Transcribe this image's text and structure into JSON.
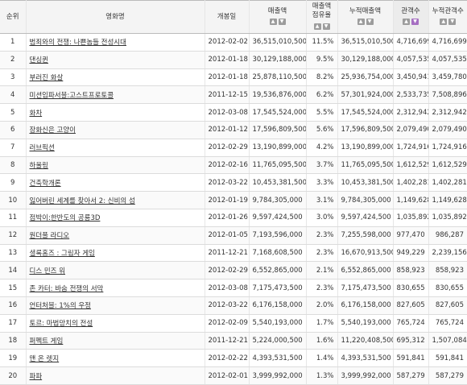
{
  "headers": {
    "rank": "순위",
    "title": "영화명",
    "release": "개봉일",
    "sales": "매출액",
    "share_line1": "매출액",
    "share_line2": "점유율",
    "cum_sales": "누적매출액",
    "audience": "관객수",
    "cum_audience": "누적관객수"
  },
  "sort_icons": {
    "up": "▲",
    "down": "▼"
  },
  "sort_active_color": "#a66fc2",
  "rows": [
    {
      "rank": "1",
      "title": "범죄와의 전쟁: 나쁜놈들 전성시대",
      "release": "2012-02-02",
      "sales": "36,515,010,500",
      "share": "11.5%",
      "cum_sales": "36,515,010,500",
      "audience": "4,716,699",
      "cum_audience": "4,716,699"
    },
    {
      "rank": "2",
      "title": "댄싱퀸",
      "release": "2012-01-18",
      "sales": "30,129,188,000",
      "share": "9.5%",
      "cum_sales": "30,129,188,000",
      "audience": "4,057,535",
      "cum_audience": "4,057,535"
    },
    {
      "rank": "3",
      "title": "부러진 화살",
      "release": "2012-01-18",
      "sales": "25,878,110,500",
      "share": "8.2%",
      "cum_sales": "25,936,754,000",
      "audience": "3,450,941",
      "cum_audience": "3,459,780"
    },
    {
      "rank": "4",
      "title": "미션임파서블:고스트프로토콜",
      "release": "2011-12-15",
      "sales": "19,536,876,000",
      "share": "6.2%",
      "cum_sales": "57,301,924,000",
      "audience": "2,533,735",
      "cum_audience": "7,508,896"
    },
    {
      "rank": "5",
      "title": "화차",
      "release": "2012-03-08",
      "sales": "17,545,524,000",
      "share": "5.5%",
      "cum_sales": "17,545,524,000",
      "audience": "2,312,942",
      "cum_audience": "2,312,942"
    },
    {
      "rank": "6",
      "title": "장화신은 고양이",
      "release": "2012-01-12",
      "sales": "17,596,809,500",
      "share": "5.6%",
      "cum_sales": "17,596,809,500",
      "audience": "2,079,490",
      "cum_audience": "2,079,490"
    },
    {
      "rank": "7",
      "title": "러브픽션",
      "release": "2012-02-29",
      "sales": "13,190,899,000",
      "share": "4.2%",
      "cum_sales": "13,190,899,000",
      "audience": "1,724,916",
      "cum_audience": "1,724,916"
    },
    {
      "rank": "8",
      "title": "하울링",
      "release": "2012-02-16",
      "sales": "11,765,095,500",
      "share": "3.7%",
      "cum_sales": "11,765,095,500",
      "audience": "1,612,529",
      "cum_audience": "1,612,529"
    },
    {
      "rank": "9",
      "title": "건축학개론",
      "release": "2012-03-22",
      "sales": "10,453,381,500",
      "share": "3.3%",
      "cum_sales": "10,453,381,500",
      "audience": "1,402,281",
      "cum_audience": "1,402,281"
    },
    {
      "rank": "10",
      "title": "잃어버린 세계를 찾아서 2: 신비의 섬",
      "release": "2012-01-19",
      "sales": "9,784,305,000",
      "share": "3.1%",
      "cum_sales": "9,784,305,000",
      "audience": "1,149,628",
      "cum_audience": "1,149,628"
    },
    {
      "rank": "11",
      "title": "점박이:한반도의 공룡3D",
      "release": "2012-01-26",
      "sales": "9,597,424,500",
      "share": "3.0%",
      "cum_sales": "9,597,424,500",
      "audience": "1,035,892",
      "cum_audience": "1,035,892"
    },
    {
      "rank": "12",
      "title": "원더풀 라디오",
      "release": "2012-01-05",
      "sales": "7,193,596,000",
      "share": "2.3%",
      "cum_sales": "7,255,598,000",
      "audience": "977,470",
      "cum_audience": "986,287"
    },
    {
      "rank": "13",
      "title": "셜록홈즈 : 그림자 게임",
      "release": "2011-12-21",
      "sales": "7,168,608,500",
      "share": "2.3%",
      "cum_sales": "16,670,913,500",
      "audience": "949,229",
      "cum_audience": "2,239,156"
    },
    {
      "rank": "14",
      "title": "디스 민즈 워",
      "release": "2012-02-29",
      "sales": "6,552,865,000",
      "share": "2.1%",
      "cum_sales": "6,552,865,000",
      "audience": "858,923",
      "cum_audience": "858,923"
    },
    {
      "rank": "15",
      "title": "존 카터: 바숨 전쟁의 서막",
      "release": "2012-03-08",
      "sales": "7,175,473,500",
      "share": "2.3%",
      "cum_sales": "7,175,473,500",
      "audience": "830,655",
      "cum_audience": "830,655"
    },
    {
      "rank": "16",
      "title": "언터처블: 1%의 우정",
      "release": "2012-03-22",
      "sales": "6,176,158,000",
      "share": "2.0%",
      "cum_sales": "6,176,158,000",
      "audience": "827,605",
      "cum_audience": "827,605"
    },
    {
      "rank": "17",
      "title": "토르: 마법망치의 전설",
      "release": "2012-02-09",
      "sales": "5,540,193,000",
      "share": "1.7%",
      "cum_sales": "5,540,193,000",
      "audience": "765,724",
      "cum_audience": "765,724"
    },
    {
      "rank": "18",
      "title": "퍼펙트 게임",
      "release": "2011-12-21",
      "sales": "5,224,000,500",
      "share": "1.6%",
      "cum_sales": "11,220,408,500",
      "audience": "695,312",
      "cum_audience": "1,507,084"
    },
    {
      "rank": "19",
      "title": "맨 온 렛지",
      "release": "2012-02-22",
      "sales": "4,393,531,500",
      "share": "1.4%",
      "cum_sales": "4,393,531,500",
      "audience": "591,841",
      "cum_audience": "591,841"
    },
    {
      "rank": "20",
      "title": "파파",
      "release": "2012-02-01",
      "sales": "3,999,992,000",
      "share": "1.3%",
      "cum_sales": "3,999,992,000",
      "audience": "587,279",
      "cum_audience": "587,279"
    }
  ]
}
